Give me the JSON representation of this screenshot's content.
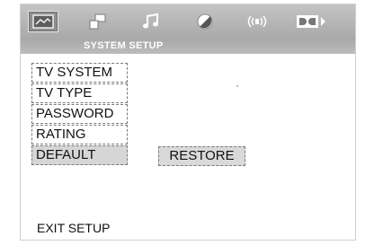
{
  "tabs": [
    {
      "icon": "tv-screen-icon",
      "active": true
    },
    {
      "icon": "speaker-setup-icon",
      "active": false
    },
    {
      "icon": "music-note-icon",
      "active": false
    },
    {
      "icon": "contrast-circle-icon",
      "active": false
    },
    {
      "icon": "surround-sound-icon",
      "active": false
    },
    {
      "icon": "dolby-logo-icon",
      "active": false
    }
  ],
  "section_title": "SYSTEM SETUP",
  "menu": {
    "items": [
      "TV SYSTEM",
      "TV TYPE",
      "PASSWORD",
      "RATING",
      "DEFAULT"
    ],
    "selected": "DEFAULT"
  },
  "option": {
    "label": "RESTORE"
  },
  "exit_label": "EXIT SETUP"
}
